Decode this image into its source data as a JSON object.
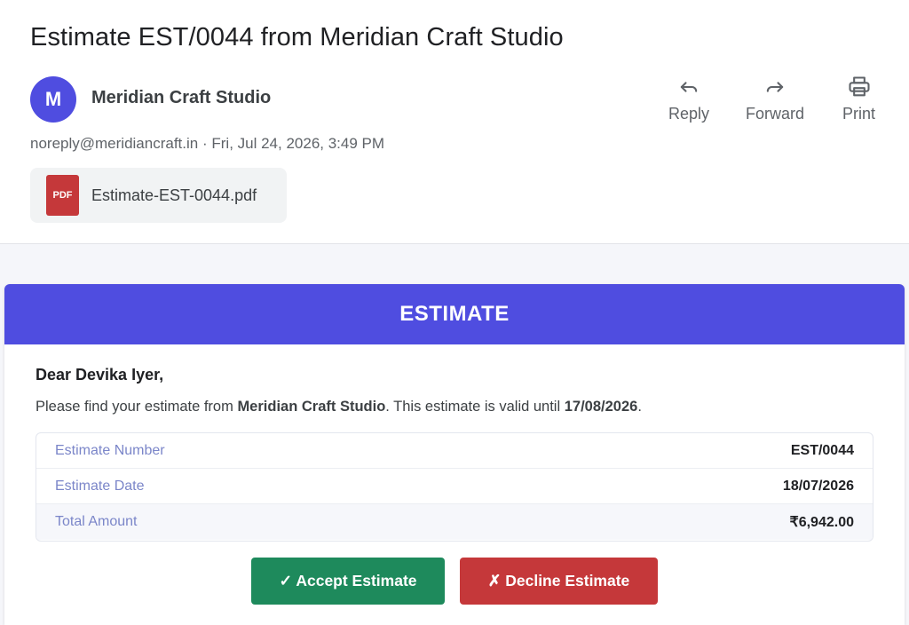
{
  "email": {
    "subject": "Estimate EST/0044 from Meridian Craft Studio",
    "sender": {
      "initial": "M",
      "name": "Meridian Craft Studio",
      "address": "noreply@meridiancraft.in",
      "separator": "·",
      "date": "Fri, Jul 24, 2026, 3:49 PM"
    },
    "actions": [
      {
        "label": "Reply",
        "icon": "reply-icon"
      },
      {
        "label": "Forward",
        "icon": "forward-icon"
      },
      {
        "label": "Print",
        "icon": "print-icon"
      }
    ],
    "attachment": {
      "badge": "PDF",
      "filename": "Estimate-EST-0044.pdf"
    }
  },
  "estimate": {
    "banner": "ESTIMATE",
    "greeting": "Dear Devika Iyer,",
    "intro_prefix": "Please find your estimate from ",
    "company": "Meridian Craft Studio",
    "intro_middle": ". This estimate is valid until ",
    "valid_until": "17/08/2026",
    "intro_suffix": ".",
    "details": [
      {
        "label": "Estimate Number",
        "value": "EST/0044"
      },
      {
        "label": "Estimate Date",
        "value": "18/07/2026"
      },
      {
        "label": "Total Amount",
        "value": "₹6,942.00"
      }
    ],
    "accept_label": "✓ Accept Estimate",
    "decline_label": "✗ Decline Estimate"
  },
  "colors": {
    "accent": "#4f4de0",
    "accept": "#1e8a5c",
    "decline": "#c5383a"
  }
}
